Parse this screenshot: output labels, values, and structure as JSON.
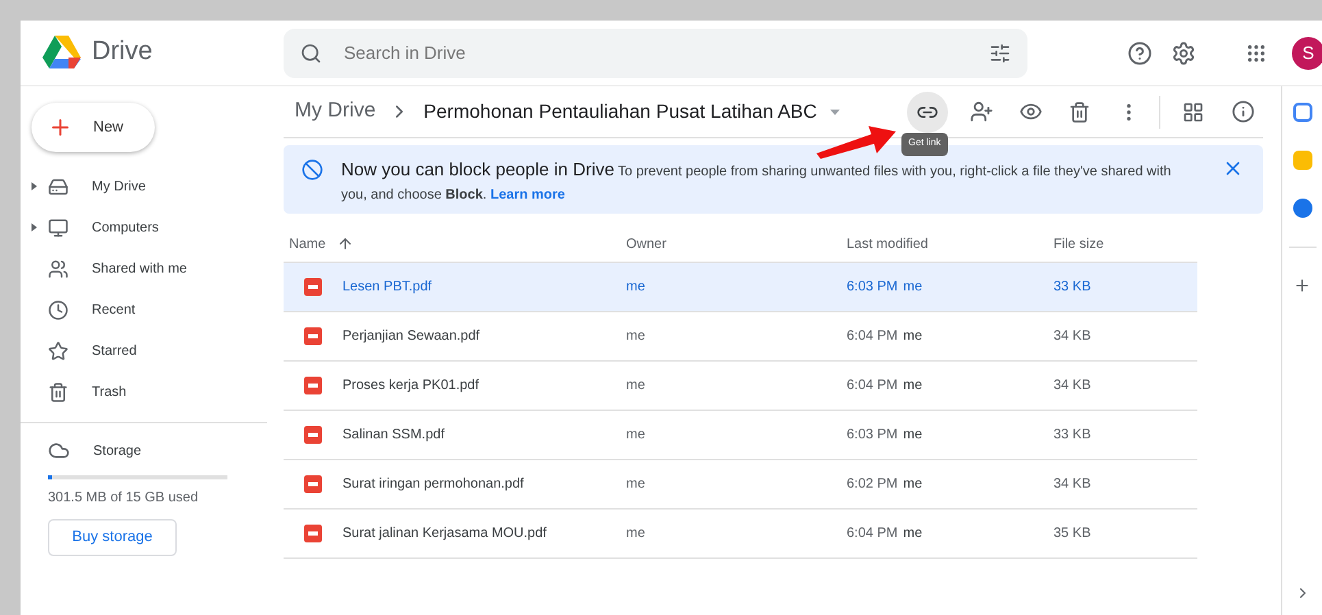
{
  "app": {
    "name": "Drive",
    "avatar_letter": "S"
  },
  "search": {
    "placeholder": "Search in Drive"
  },
  "new_button": {
    "label": "New"
  },
  "sidebar": {
    "items": [
      {
        "label": "My Drive",
        "expandable": true
      },
      {
        "label": "Computers",
        "expandable": true
      },
      {
        "label": "Shared with me",
        "expandable": false
      },
      {
        "label": "Recent",
        "expandable": false
      },
      {
        "label": "Starred",
        "expandable": false
      },
      {
        "label": "Trash",
        "expandable": false
      }
    ],
    "storage": {
      "label": "Storage",
      "level": 0.02,
      "usage": "301.5 MB of 15 GB used",
      "button": "Buy storage"
    }
  },
  "breadcrumb": [
    "My Drive",
    "Permohonan Pentauliahan Pusat Latihan ABC"
  ],
  "tooltip": "Get link",
  "banner": {
    "title": "Now you can block people in Drive",
    "text": "To prevent people from sharing unwanted files with you, right-click a file they've shared with you, and choose **Block**.",
    "link": "Learn more"
  },
  "table": {
    "columns": [
      "Name",
      "Owner",
      "Last modified",
      "File size"
    ],
    "rows": [
      {
        "name": "Lesen PBT.pdf",
        "owner": "me",
        "modified": "6:03 PM",
        "modifier": "me",
        "size": "33 KB",
        "selected": true
      },
      {
        "name": "Perjanjian Sewaan.pdf",
        "owner": "me",
        "modified": "6:04 PM",
        "modifier": "me",
        "size": "34 KB",
        "selected": false
      },
      {
        "name": "Proses kerja PK01.pdf",
        "owner": "me",
        "modified": "6:04 PM",
        "modifier": "me",
        "size": "34 KB",
        "selected": false
      },
      {
        "name": "Salinan SSM.pdf",
        "owner": "me",
        "modified": "6:03 PM",
        "modifier": "me",
        "size": "33 KB",
        "selected": false
      },
      {
        "name": "Surat iringan permohonan.pdf",
        "owner": "me",
        "modified": "6:02 PM",
        "modifier": "me",
        "size": "34 KB",
        "selected": false
      },
      {
        "name": "Surat jalinan Kerjasama MOU.pdf",
        "owner": "me",
        "modified": "6:04 PM",
        "modifier": "me",
        "size": "35 KB",
        "selected": false
      }
    ]
  }
}
